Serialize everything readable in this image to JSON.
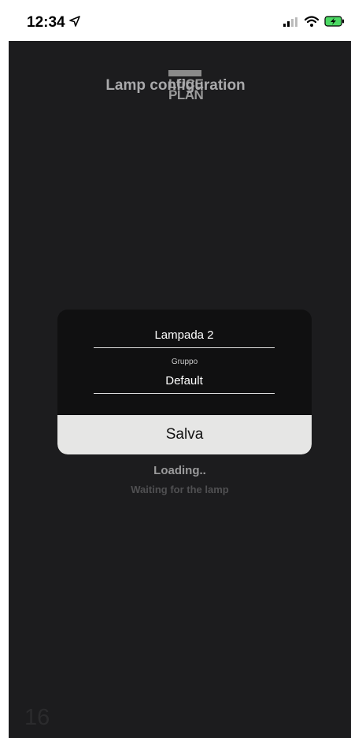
{
  "status_bar": {
    "time": "12:34",
    "icons": [
      "location-arrow-icon",
      "signal-icon",
      "wifi-icon",
      "battery-charging-icon"
    ]
  },
  "header": {
    "logo_text_line1": "LUCE",
    "logo_text_line2": "PLAN",
    "title": "Lamp configuration"
  },
  "dialog": {
    "lamp_name": "Lampada 2",
    "group_label": "Gruppo",
    "group_value": "Default",
    "save_label": "Salva"
  },
  "status": {
    "loading": "Loading..",
    "waiting": "Waiting for the lamp"
  },
  "footer": {
    "number": "16"
  },
  "colors": {
    "background": "#1c1c1e",
    "dialog": "#101011",
    "button": "#e6e6e5"
  }
}
